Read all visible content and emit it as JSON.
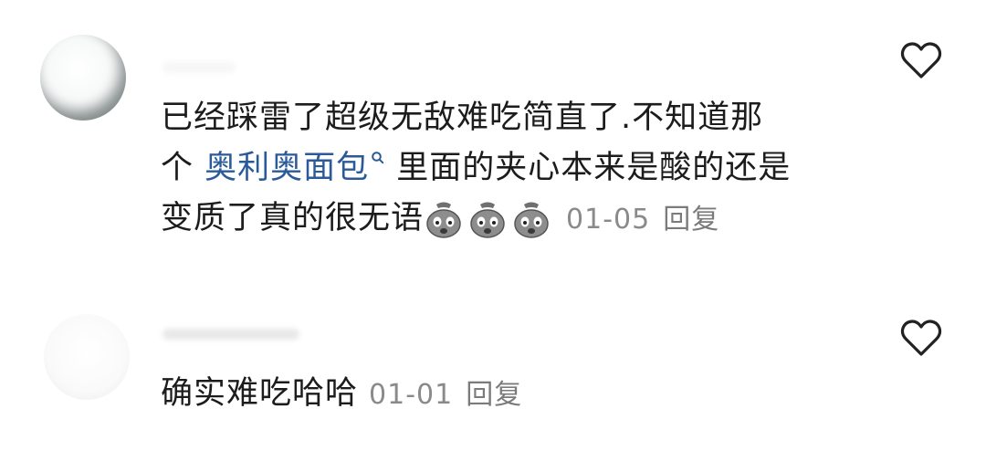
{
  "comments": [
    {
      "id": "c1",
      "line1": "已经踩雷了超级无敌难吃简直了.不知道那",
      "line2_prefix": "个 ",
      "link_text": "奥利奥面包",
      "line2_suffix": " 里面的夹心本来是酸的还是",
      "line3": "变质了真的很无语",
      "emoji_count": 3,
      "time": "01-05",
      "reply_label": "回复",
      "icon_like": "heart-outline-icon",
      "icon_search": "search-icon"
    },
    {
      "id": "c2",
      "line1": "确实难吃哈哈",
      "time": "01-01",
      "reply_label": "回复",
      "icon_like": "heart-outline-icon"
    }
  ],
  "colors": {
    "text": "#1c1c1c",
    "link": "#2a5a98",
    "meta": "#8a8a8a",
    "icon": "#222222"
  }
}
